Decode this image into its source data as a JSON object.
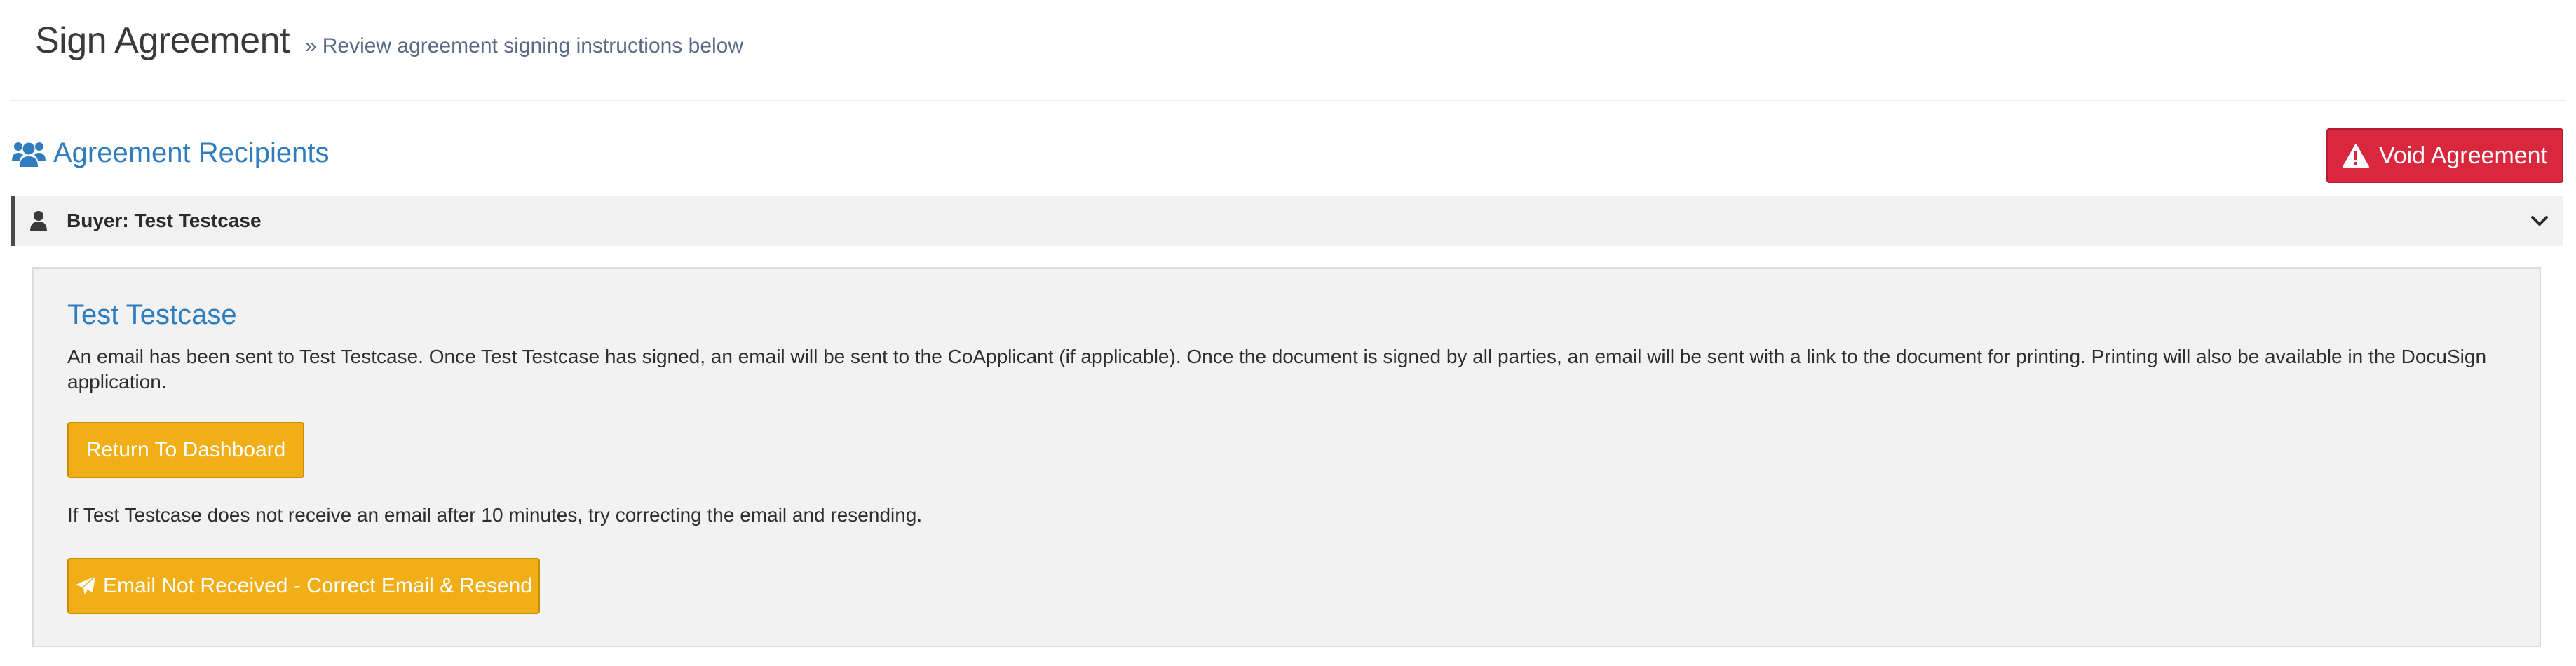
{
  "header": {
    "title": "Sign Agreement",
    "subtitle_icon": "double-chevron-right-icon",
    "subtitle": "Review agreement signing instructions below"
  },
  "recipients_section": {
    "icon": "users-icon",
    "title": "Agreement Recipients",
    "void_button": {
      "icon": "warning-icon",
      "label": "Void Agreement"
    }
  },
  "recipient": {
    "icon": "user-icon",
    "label": "Buyer: Test Testcase",
    "toggle_icon": "chevron-down-icon",
    "name": "Test Testcase",
    "instructions": "An email has been sent to Test Testcase. Once Test Testcase has signed, an email will be sent to the CoApplicant (if applicable). Once the document is signed by all parties, an email will be sent with a link to the document for printing. Printing will also be available in the DocuSign application.",
    "dashboard_button": "Return To Dashboard",
    "note": "If Test Testcase does not receive an email after 10 minutes, try correcting the email and resending.",
    "resend_button": {
      "icon": "paper-plane-icon",
      "label": "Email Not Received - Correct Email & Resend"
    }
  },
  "colors": {
    "accent_blue": "#2f7dbf",
    "danger": "#d9273e",
    "warning": "#f2ae16",
    "panel_bg": "#f2f2f2"
  }
}
